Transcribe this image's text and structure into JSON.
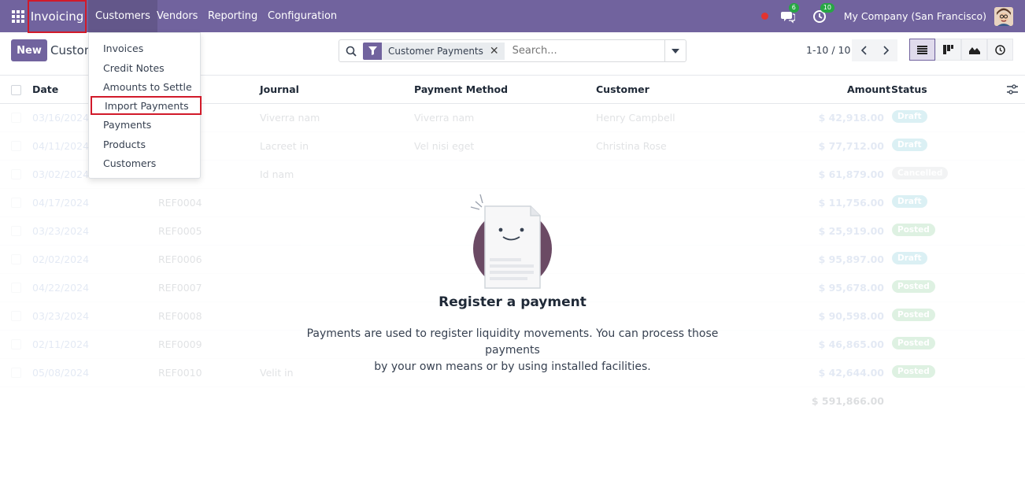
{
  "navbar": {
    "brand": "Invoicing",
    "menus": [
      "Customers",
      "Vendors",
      "Reporting",
      "Configuration"
    ],
    "chat_badge": "6",
    "activity_badge": "10",
    "company": "My Company (San Francisco)"
  },
  "customers_menu": {
    "items": [
      "Invoices",
      "Credit Notes",
      "Amounts to Settle",
      "Import Payments",
      "Payments",
      "Products",
      "Customers"
    ],
    "highlighted": "Import Payments"
  },
  "control_panel": {
    "new_label": "New",
    "breadcrumb": "Custom",
    "facet": "Customer Payments",
    "search_placeholder": "Search...",
    "pager": "1-10 / 10"
  },
  "table": {
    "columns": [
      "Date",
      "Journal",
      "Payment Method",
      "Customer",
      "Amount",
      "Status"
    ],
    "rows": [
      {
        "date": "03/16/2024",
        "number": "",
        "journal": "Viverra nam",
        "method": "Viverra nam",
        "customer": "Henry Campbell",
        "amount": "$ 42,918.00",
        "status": "Draft"
      },
      {
        "date": "04/11/2024",
        "number": "",
        "journal": "Lacreet in",
        "method": "Vel nisi eget",
        "customer": "Christina Rose",
        "amount": "$ 77,712.00",
        "status": "Draft"
      },
      {
        "date": "03/02/2024",
        "number": "",
        "journal": "Id nam",
        "method": "",
        "customer": "",
        "amount": "$ 61,879.00",
        "status": "Cancelled"
      },
      {
        "date": "04/17/2024",
        "number": "REF0004",
        "journal": "",
        "method": "",
        "customer": "",
        "amount": "$ 11,756.00",
        "status": "Draft"
      },
      {
        "date": "03/23/2024",
        "number": "REF0005",
        "journal": "",
        "method": "",
        "customer": "",
        "amount": "$ 25,919.00",
        "status": "Posted"
      },
      {
        "date": "02/02/2024",
        "number": "REF0006",
        "journal": "",
        "method": "",
        "customer": "",
        "amount": "$ 95,897.00",
        "status": "Draft"
      },
      {
        "date": "04/22/2024",
        "number": "REF0007",
        "journal": "",
        "method": "",
        "customer": "",
        "amount": "$ 95,678.00",
        "status": "Posted"
      },
      {
        "date": "03/23/2024",
        "number": "REF0008",
        "journal": "",
        "method": "",
        "customer": "",
        "amount": "$ 90,598.00",
        "status": "Posted"
      },
      {
        "date": "02/11/2024",
        "number": "REF0009",
        "journal": "",
        "method": "",
        "customer": "",
        "amount": "$ 46,865.00",
        "status": "Posted"
      },
      {
        "date": "05/08/2024",
        "number": "REF0010",
        "journal": "Velit in",
        "method": "",
        "customer": "",
        "amount": "$ 42,644.00",
        "status": "Posted"
      }
    ],
    "total": "$ 591,866.00"
  },
  "helper": {
    "title": "Register a payment",
    "text_line1": "Payments are used to register liquidity movements. You can process those payments",
    "text_line2": "by your own means or by using installed facilities."
  },
  "colors": {
    "brand": "#71639e",
    "draft": "#17a2b8",
    "posted": "#28a745",
    "cancelled": "#adb5bd",
    "highlight_border": "#d11a2a"
  }
}
